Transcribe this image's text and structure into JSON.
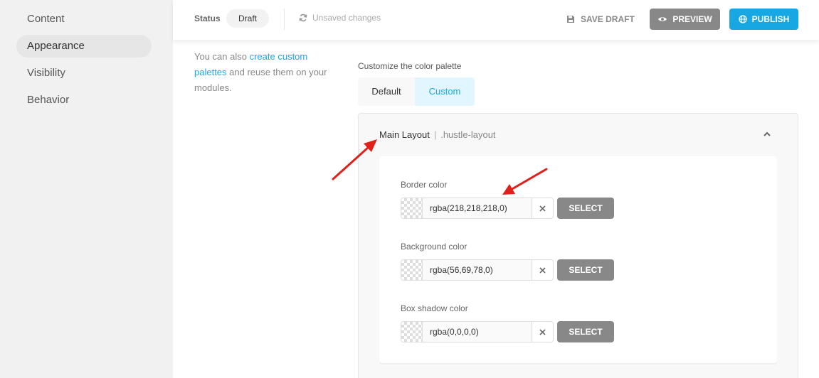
{
  "sidebar": {
    "items": [
      {
        "label": "Content"
      },
      {
        "label": "Appearance"
      },
      {
        "label": "Visibility"
      },
      {
        "label": "Behavior"
      }
    ]
  },
  "topbar": {
    "status_label": "Status",
    "status_value": "Draft",
    "unsaved_label": "Unsaved changes",
    "save_draft_label": "SAVE DRAFT",
    "preview_label": "PREVIEW",
    "publish_label": "PUBLISH"
  },
  "description": {
    "prefix": "You can also ",
    "link": "create custom palettes",
    "suffix": " and reuse them on your modules."
  },
  "palette": {
    "label": "Customize the color palette",
    "tabs": [
      {
        "label": "Default"
      },
      {
        "label": "Custom"
      }
    ]
  },
  "accordion": {
    "title": "Main Layout",
    "separator": "|",
    "css_class": ".hustle-layout",
    "fields": [
      {
        "label": "Border color",
        "value": "rgba(218,218,218,0)",
        "select_label": "SELECT"
      },
      {
        "label": "Background color",
        "value": "rgba(56,69,78,0)",
        "select_label": "SELECT"
      },
      {
        "label": "Box shadow color",
        "value": "rgba(0,0,0,0)",
        "select_label": "SELECT"
      }
    ]
  },
  "colors": {
    "accent": "#17a8e3",
    "button_gray": "#888888",
    "annotation_red": "#e0201a"
  }
}
